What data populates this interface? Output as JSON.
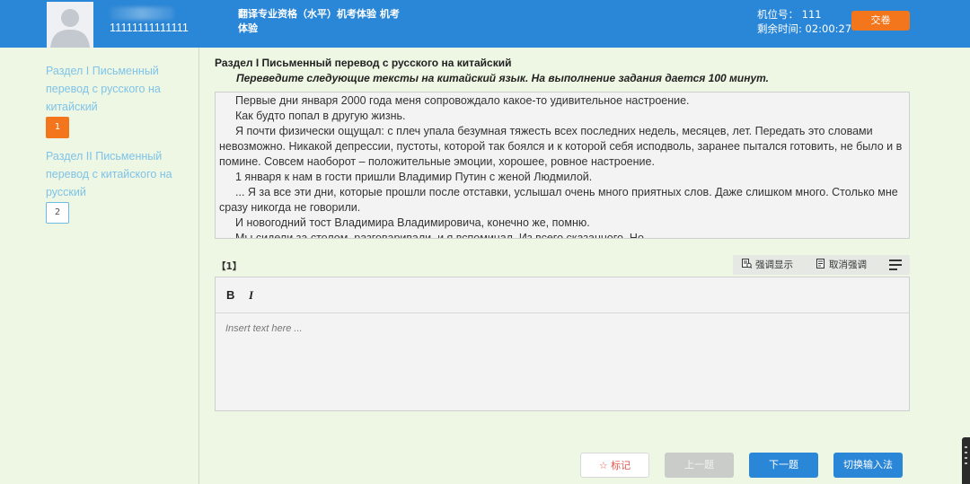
{
  "header": {
    "user_id": "11111111111111",
    "exam_title": "翻译专业资格（水平）机考体验 机考体验",
    "seat_label": "机位号：",
    "seat_number": "111",
    "time_label": "剩余时间:",
    "time_remaining": "02:00:27",
    "submit_label": "交卷"
  },
  "sidebar": {
    "sections": [
      {
        "label": "Раздел I Письменный перевод с русского на китайский",
        "questions": [
          "1"
        ]
      },
      {
        "label": "Раздел II Письменный перевод с китайского на русский",
        "questions": [
          "2"
        ]
      }
    ]
  },
  "main": {
    "section_title": "Раздел I Письменный перевод с русского на китайский",
    "instruction": "Переведите следующие тексты на китайский язык. На выполнение задания дается 100 минут.",
    "passage": [
      "Первые дни января 2000 года меня сопровождало какое-то удивительное настроение.",
      "Как будто попал в другую жизнь.",
      "Я почти физически ощущал: с плеч упала безумная тяжесть всех последних недель, месяцев, лет. Передать это словами невозможно. Никакой депрессии, пустоты, которой так боялся и к которой себя исподволь, заранее пытался готовить, не было и в помине. Совсем наоборот – положительные эмоции, хорошее, ровное настроение.",
      "1 января к нам в гости пришли Владимир Путин с женой Людмилой.",
      "... Я за все эти дни, которые прошли после отставки, услышал очень много приятных слов. Даже слишком много. Столько мне сразу никогда не говорили.",
      "И новогодний тост Владимира Владимировича, конечно же, помню.",
      "Мы сидели за столом, разговаривали, и я вспоминал. Из всего сказанного. Но"
    ],
    "question_label": "【1】",
    "highlight_label": "强调显示",
    "unhighlight_label": "取消强调",
    "bold_label": "B",
    "italic_label": "I",
    "editor_placeholder": "Insert text here ..."
  },
  "footer": {
    "mark_label": "☆ 标记",
    "prev_label": "上一题",
    "next_label": "下一题",
    "ime_label": "切换输入法"
  }
}
